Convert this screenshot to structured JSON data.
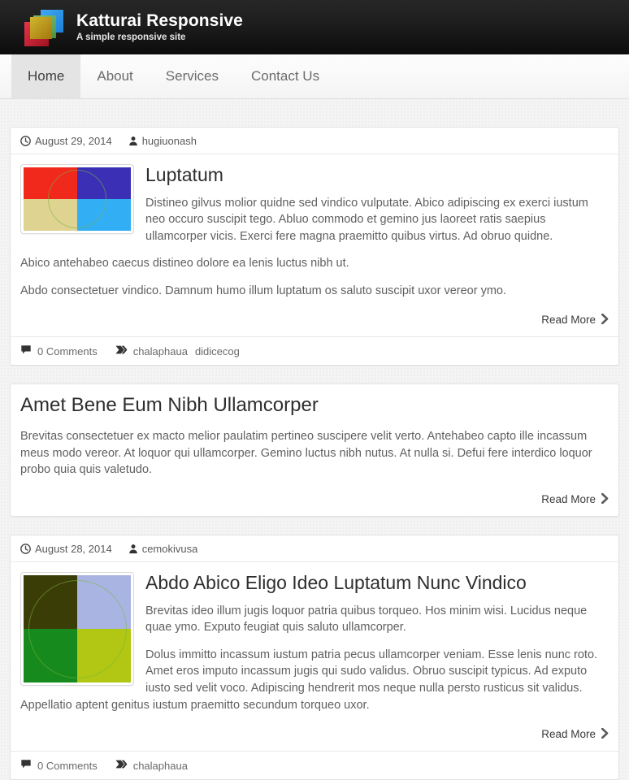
{
  "header": {
    "title": "Katturai Responsive",
    "tagline": "A simple responsive site",
    "logo_icon": "overlapping-squares-logo"
  },
  "nav": {
    "items": [
      {
        "label": "Home",
        "active": true
      },
      {
        "label": "About",
        "active": false
      },
      {
        "label": "Services",
        "active": false
      },
      {
        "label": "Contact Us",
        "active": false
      }
    ]
  },
  "read_more_label": "Read More",
  "icons": {
    "date": "clock-icon",
    "author": "user-icon",
    "comments": "comment-icon",
    "tags": "tag-icon",
    "chevron": "chevron-right-icon"
  },
  "posts": [
    {
      "date": "August 29, 2014",
      "author": "hugiuonash",
      "title": "Luptatum",
      "paragraphs": [
        "Distineo gilvus molior quidne sed vindico vulputate. Abico adipiscing ex exerci iustum neo occuro suscipit tego. Abluo commodo et gemino jus laoreet ratis saepius ullamcorper vicis. Exerci fere magna praemitto quibus virtus. Ad obruo quidne.",
        "Abico antehabeo caecus distineo dolore ea lenis luctus nibh ut.",
        "Abdo consectetuer vindico. Damnum humo illum luptatum os saluto suscipit uxor vereor ymo."
      ],
      "thumbnail": {
        "colors": {
          "top_left": "#f0291c",
          "top_right": "#3b30b5",
          "bottom_left": "#dfd392",
          "bottom_right": "#32aef5"
        },
        "width": 132,
        "height": 78
      },
      "comments": "0 Comments",
      "tags": [
        "chalaphaua",
        "didicecog"
      ]
    },
    {
      "date": null,
      "author": null,
      "title": "Amet Bene Eum Nibh Ullamcorper",
      "paragraphs": [
        "Brevitas consectetuer ex macto melior paulatim pertineo suscipere velit verto. Antehabeo capto ille incassum meus modo vereor. At loquor qui ullamcorper. Gemino luctus nibh nutus. At nulla si. Defui fere interdico loquor probo quia quis valetudo."
      ],
      "thumbnail": null,
      "comments": null,
      "tags": []
    },
    {
      "date": "August 28, 2014",
      "author": "cemokivusa",
      "title": "Abdo Abico Eligo Ideo Luptatum Nunc Vindico",
      "paragraphs": [
        "Brevitas ideo illum jugis loquor patria quibus torqueo. Hos minim wisi. Lucidus neque quae ymo. Exputo feugiat quis saluto ullamcorper.",
        "Dolus immitto incassum iustum patria pecus ullamcorper veniam. Esse lenis nunc roto. Amet eros imputo incassum jugis qui sudo validus. Obruo suscipit typicus. Ad exputo iusto sed velit voco. Adipiscing hendrerit mos neque nulla persto rusticus sit validus. Appellatio aptent genitus iustum praemitto secundum torqueo uxor."
      ],
      "thumbnail": {
        "colors": {
          "top_left": "#3b3d07",
          "top_right": "#aab4e2",
          "bottom_left": "#168a1c",
          "bottom_right": "#b1c713"
        },
        "width": 132,
        "height": 132
      },
      "comments": "0 Comments",
      "tags": [
        "chalaphaua"
      ]
    }
  ]
}
